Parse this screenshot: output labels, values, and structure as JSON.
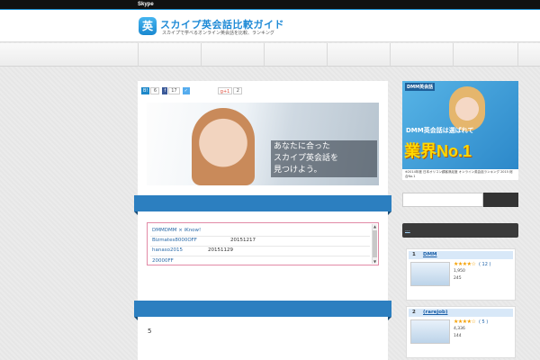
{
  "topbar": {
    "title": "Skype"
  },
  "header": {
    "logo_char": "英",
    "site_title": "スカイプ英会話比較ガイド",
    "site_subtitle": "スカイプで学べるオンライン英会話を比較、ランキング"
  },
  "share": {
    "hatena_count": "6",
    "fb_count": "17",
    "tweet_label": "✓",
    "gplus_label": "g+1",
    "gplus_count": "2"
  },
  "hero": {
    "text": "あなたに合った\nスカイプ英会話を\n見つけよう。"
  },
  "notice": {
    "rows": [
      {
        "a": "DMMDMM × iKnow!",
        "b": ""
      },
      {
        "a": "Bizmates8000OFF",
        "b": "20151217"
      },
      {
        "a": "hanaso2015",
        "b": "20151129"
      },
      {
        "a": "",
        "b": ""
      },
      {
        "a": "20000FF",
        "b": ""
      }
    ]
  },
  "body_text": "5",
  "ad": {
    "brand": "DMM英会話",
    "line1": "DMM英会話は選ばれて",
    "line2": "業界No.1",
    "foot": "※2014年度 日本オリコン顧客満足度 オンライン英会話ランキング 2015 総合No.1"
  },
  "sidebar": {
    "head_link": "...",
    "ranks": [
      {
        "num": "1",
        "name": "DMM",
        "stars": "★★★★☆",
        "reviews": "( 12 )",
        "info1": "1,950",
        "info2": "245"
      },
      {
        "num": "2",
        "name": "(rarejob)",
        "stars": "★★★★☆",
        "reviews": "( 5 )",
        "info1": "4,336",
        "info2": "144"
      }
    ]
  },
  "colors": {
    "accent": "#2c7fc0",
    "topbar": "#111111",
    "title_blue": "#1e8ad6"
  }
}
